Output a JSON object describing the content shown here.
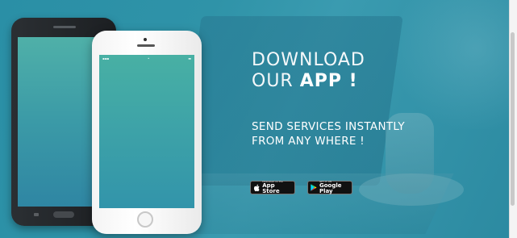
{
  "headline": {
    "line1": "DOWNLOAD",
    "line2_prefix": "OUR ",
    "line2_bold": "APP !"
  },
  "subline": {
    "line1": "SEND SERVICES INSTANTLY",
    "line2": "FROM ANY WHERE !"
  },
  "badges": {
    "app_store": {
      "small": "Download on the",
      "big": "App Store",
      "icon": "apple-icon"
    },
    "google_play": {
      "small": "GET IT ON",
      "big": "Google Play",
      "icon": "google-play-icon"
    }
  },
  "colors": {
    "banner_teal": "#2f93a8",
    "text": "#ffffff"
  }
}
